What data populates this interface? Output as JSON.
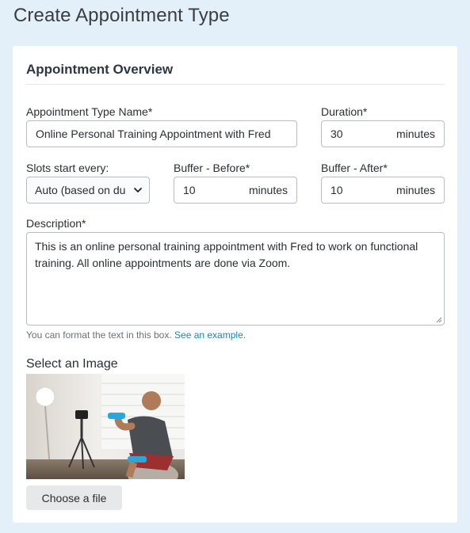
{
  "page": {
    "title": "Create Appointment Type"
  },
  "overview": {
    "heading": "Appointment Overview",
    "name_label": "Appointment Type Name*",
    "name_value": "Online Personal Training Appointment with Fred",
    "duration_label": "Duration*",
    "duration_value": "30",
    "duration_unit": "minutes",
    "slots_label": "Slots start every:",
    "slots_value": "Auto (based on du",
    "buffer_before_label": "Buffer - Before*",
    "buffer_before_value": "10",
    "buffer_before_unit": "minutes",
    "buffer_after_label": "Buffer - After*",
    "buffer_after_value": "10",
    "buffer_after_unit": "minutes",
    "description_label": "Description*",
    "description_value": "This is an online personal training appointment with Fred to work on functional training. All online appointments are done via Zoom.",
    "help_text": "You can format the text in this box.",
    "help_link": "See an example."
  },
  "image_section": {
    "heading": "Select an Image",
    "choose_file_label": "Choose a file"
  },
  "colors": {
    "page_background": "#e3f0fa",
    "card_background": "#ffffff",
    "link": "#1a86b8",
    "button_background": "#e7e8ea"
  },
  "icons": {
    "select_arrow": "chevron-down-icon"
  }
}
